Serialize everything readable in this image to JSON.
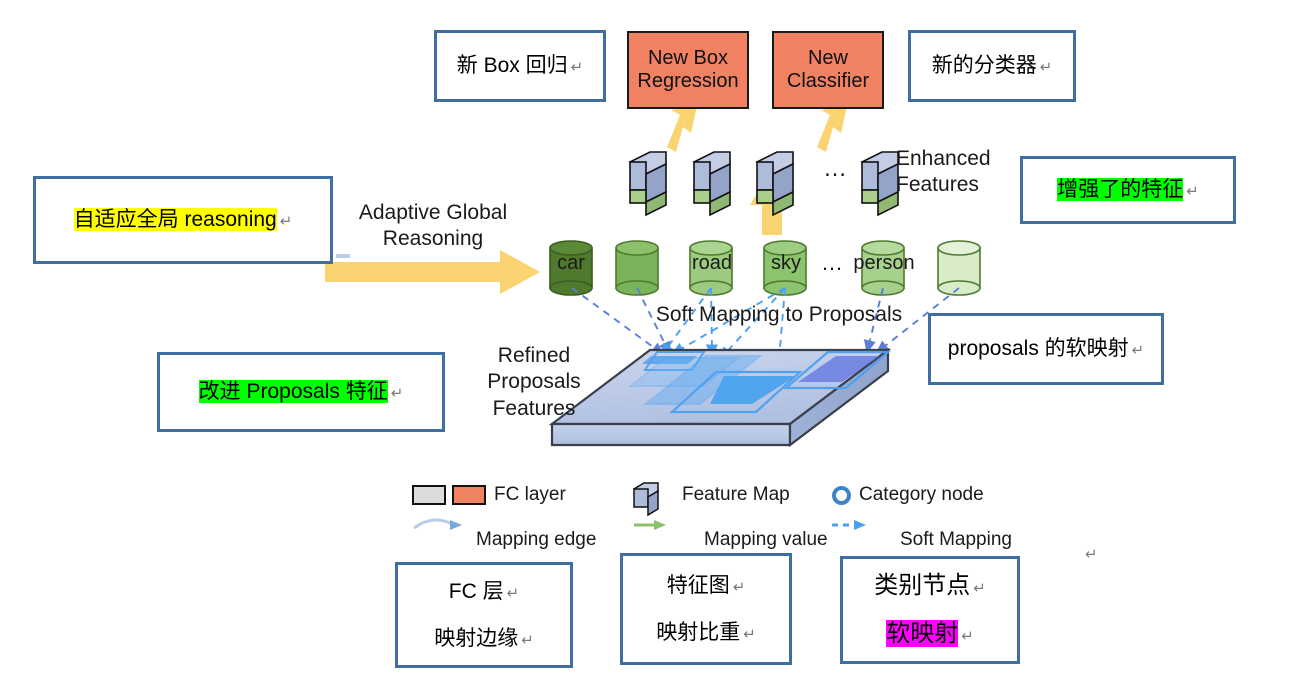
{
  "diagram": {
    "title": "Adaptive Global Reasoning framework with soft mapping to proposals",
    "colors": {
      "annotation_border": "#3f6fa0",
      "fc_orange": "#f08262",
      "arrow_yellow": "#fad473",
      "soft_mapping_blue": "#4d9ff0",
      "mapping_edge_blue": "#a8c4e8",
      "mapping_value_green": "#8cc06a",
      "category_node_ring": "#3d85c8",
      "highlight_yellow": "#ffff00",
      "highlight_green": "#00ff00",
      "highlight_magenta": "#ff00ff",
      "feature_map_top": "#aebcdc",
      "feature_map_bottom": "#a8ce89",
      "slab_fill": "#b8c6e4"
    }
  },
  "annotations": {
    "new_box_regression_cn": {
      "text": "新 Box 回归",
      "pilcrow": "↵"
    },
    "new_classifier_cn": {
      "text": "新的分类器",
      "pilcrow": "↵"
    },
    "enhanced_features_cn": {
      "text": "增强了的特征",
      "pilcrow": "↵",
      "highlight": "green"
    },
    "adaptive_reasoning_cn": {
      "text": "自适应全局 reasoning",
      "pilcrow": "↵",
      "highlight": "yellow"
    },
    "refined_proposals_cn": {
      "text": "改进 Proposals 特征",
      "pilcrow": "↵",
      "highlight": "green"
    },
    "soft_mapping_cn": {
      "text": "proposals 的软映射",
      "pilcrow": "↵"
    },
    "fc_layer_cn": {
      "line1": "FC 层",
      "line2": "映射边缘",
      "pilcrow": "↵"
    },
    "feature_map_cn": {
      "line1": "特征图",
      "line2": "映射比重",
      "pilcrow": "↵"
    },
    "category_cn": {
      "line1": "类别节点",
      "line2": "软映射",
      "pilcrow": "↵",
      "highlight2": "magenta"
    }
  },
  "fc_boxes": [
    {
      "id": "new-box-regression",
      "line1": "New Box",
      "line2": "Regression"
    },
    {
      "id": "new-classifier",
      "line1": "New",
      "line2": "Classifier"
    }
  ],
  "diagram_labels": {
    "enhanced_features": "Enhanced\nFeatures",
    "adaptive_global_reasoning": "Adaptive Global\nReasoning",
    "soft_mapping_to_proposals": "Soft Mapping to Proposals",
    "refined_proposals_features": "Refined\nProposals\nFeatures",
    "ellipsis_top": "…",
    "ellipsis_nodes": "…"
  },
  "category_nodes": [
    {
      "label": "car",
      "shade": "#4f7a2e"
    },
    {
      "label": "",
      "shade": "#79b35a"
    },
    {
      "label": "road",
      "shade": "#9ccb7f"
    },
    {
      "label": "sky",
      "shade": "#8cc36d"
    },
    {
      "label": "person",
      "shade": "#a6d18c"
    },
    {
      "label": "",
      "shade": "#d8ecca"
    }
  ],
  "legend": {
    "row1": [
      {
        "icon": "fc-layer-swatches",
        "label": "FC layer"
      },
      {
        "icon": "feature-map-cube",
        "label": "Feature Map"
      },
      {
        "icon": "category-node-ring",
        "label": "Category node"
      }
    ],
    "row2": [
      {
        "icon": "mapping-edge-arrow",
        "label": "Mapping edge"
      },
      {
        "icon": "mapping-value-arrow",
        "label": "Mapping value"
      },
      {
        "icon": "soft-mapping-arrow",
        "label": "Soft Mapping"
      }
    ]
  },
  "stray_marks": [
    {
      "text": "↵"
    }
  ]
}
